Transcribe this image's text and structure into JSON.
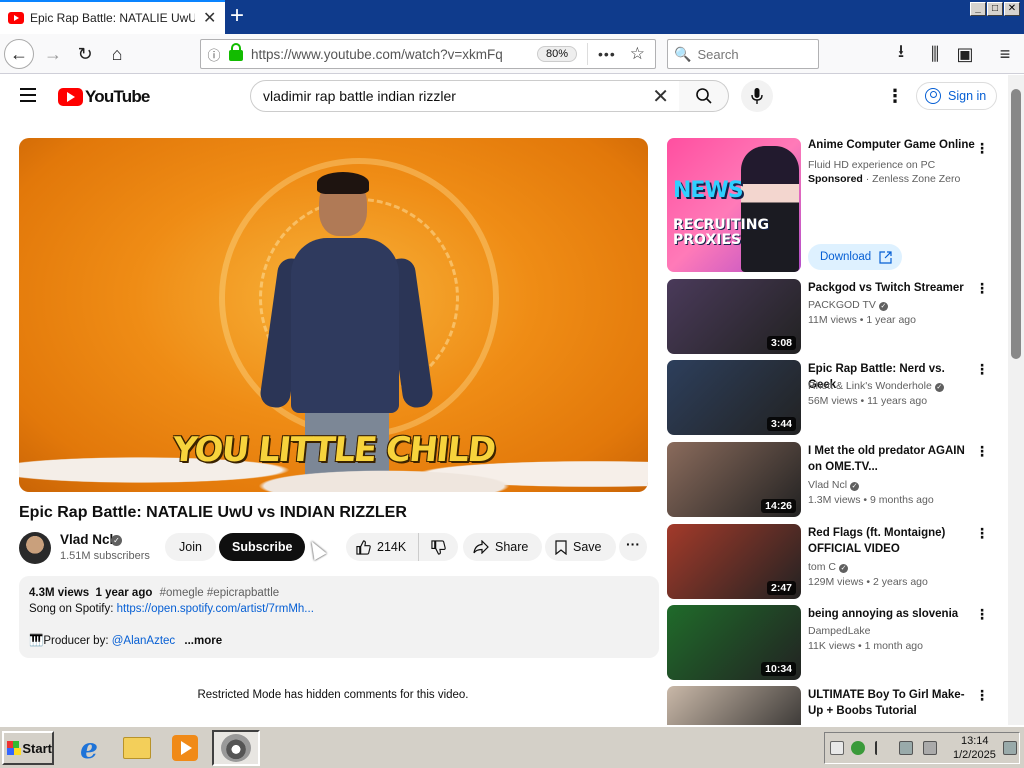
{
  "browser": {
    "tab_title": "Epic Rap Battle: NATALIE UwU vs INDIAN RIZZLER - YouTube",
    "url": "https://www.youtube.com/watch?v=xkmFq",
    "zoom": "80%",
    "search_placeholder": "Search"
  },
  "masthead": {
    "logo_text": "YouTube",
    "search_query": "vladimir rap battle indian rizzler",
    "signin_label": "Sign in"
  },
  "video": {
    "caption": "YOU LITTLE CHILD",
    "title": "Epic Rap Battle: NATALIE UwU vs INDIAN RIZZLER",
    "channel_name": "Vlad Ncl",
    "subscribers": "1.51M subscribers",
    "join_label": "Join",
    "subscribe_label": "Subscribe",
    "likes": "214K",
    "share_label": "Share",
    "save_label": "Save"
  },
  "description": {
    "views": "4.3M views",
    "age": "1 year ago",
    "tags": "#omegle #epicrapbattle",
    "spotify_label": "Song on Spotify:",
    "spotify_link": "https://open.spotify.com/artist/7rmMh...",
    "producer_label": "🎹Producer by:",
    "producer_link": "@AlanAztec",
    "more_label": "...more"
  },
  "restricted_notice": "Restricted Mode has hidden comments for this video.",
  "ad": {
    "thumb_text_1": "NEWS",
    "thumb_text_2": "RECRUITING PROXIES",
    "title": "Anime Computer Game Online",
    "subtitle": "Fluid HD experience on PC",
    "sponsored": "Sponsored",
    "advertiser": "· Zenless Zone Zero",
    "download_label": "Download"
  },
  "recommendations": [
    {
      "title": "Packgod vs Twitch Streamer",
      "channel": "PACKGOD TV",
      "verified": true,
      "views": "11M views",
      "age": "1 year ago",
      "duration": "3:08",
      "color": "#4a3a5a"
    },
    {
      "title": "Epic Rap Battle: Nerd vs. Geek",
      "channel": "Rhett & Link's Wonderhole",
      "verified": true,
      "views": "56M views",
      "age": "11 years ago",
      "duration": "3:44",
      "color": "#2d3f5c"
    },
    {
      "title": "I Met the old predator AGAIN on OME.TV...",
      "channel": "Vlad Ncl",
      "verified": true,
      "views": "1.3M views",
      "age": "9 months ago",
      "duration": "14:26",
      "color": "#8a6b5c"
    },
    {
      "title": "Red Flags (ft. Montaigne) OFFICIAL VIDEO",
      "channel": "tom C",
      "verified": true,
      "views": "129M views",
      "age": "2 years ago",
      "duration": "2:47",
      "color": "#a33a2a"
    },
    {
      "title": "being annoying as slovenia",
      "channel": "DampedLake",
      "verified": false,
      "views": "11K views",
      "age": "1 month ago",
      "duration": "10:34",
      "color": "#1f6b2a"
    },
    {
      "title": "ULTIMATE Boy To Girl Make-Up + Boobs Tutorial",
      "channel": "",
      "verified": false,
      "views": "",
      "age": "",
      "duration": "",
      "color": "#c9b8a8"
    }
  ],
  "taskbar": {
    "start_label": "Start",
    "time": "13:14",
    "date": "1/2/2025"
  }
}
